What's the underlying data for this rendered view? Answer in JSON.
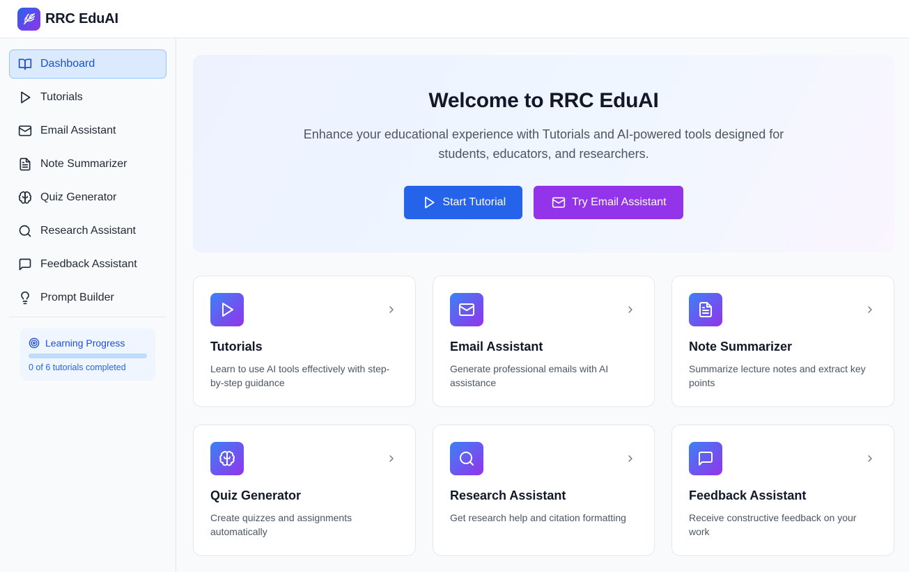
{
  "app": {
    "name": "RRC EduAI",
    "logo_icon": "sparkle-feather-icon",
    "brand_gradient": [
      "#2563eb",
      "#9333ea"
    ]
  },
  "sidebar": {
    "items": [
      {
        "label": "Dashboard",
        "icon": "book-open-icon",
        "active": true
      },
      {
        "label": "Tutorials",
        "icon": "play-icon"
      },
      {
        "label": "Email Assistant",
        "icon": "mail-icon"
      },
      {
        "label": "Note Summarizer",
        "icon": "file-text-icon"
      },
      {
        "label": "Quiz Generator",
        "icon": "brain-icon"
      },
      {
        "label": "Research Assistant",
        "icon": "search-icon"
      },
      {
        "label": "Feedback Assistant",
        "icon": "message-square-icon"
      },
      {
        "label": "Prompt Builder",
        "icon": "lightbulb-icon"
      }
    ],
    "progress": {
      "title": "Learning Progress",
      "icon": "target-icon",
      "completed": 0,
      "total": 6,
      "text": "0 of 6 tutorials completed"
    }
  },
  "hero": {
    "title": "Welcome to RRC EduAI",
    "subtitle": "Enhance your educational experience with Tutorials and AI-powered tools designed for students, educators, and researchers.",
    "primary_button": "Start Tutorial",
    "secondary_button": "Try Email Assistant"
  },
  "cards": [
    {
      "title": "Tutorials",
      "description": "Learn to use AI tools effectively with step-by-step guidance",
      "icon": "play-icon"
    },
    {
      "title": "Email Assistant",
      "description": "Generate professional emails with AI assistance",
      "icon": "mail-icon"
    },
    {
      "title": "Note Summarizer",
      "description": "Summarize lecture notes and extract key points",
      "icon": "file-text-icon"
    },
    {
      "title": "Quiz Generator",
      "description": "Create quizzes and assignments automatically",
      "icon": "brain-icon"
    },
    {
      "title": "Research Assistant",
      "description": "Get research help and citation formatting",
      "icon": "search-icon"
    },
    {
      "title": "Feedback Assistant",
      "description": "Receive constructive feedback on your work",
      "icon": "message-square-icon"
    }
  ],
  "colors": {
    "primary_blue": "#2563eb",
    "primary_purple": "#9333ea",
    "active_nav_bg": "#dbeafe"
  }
}
